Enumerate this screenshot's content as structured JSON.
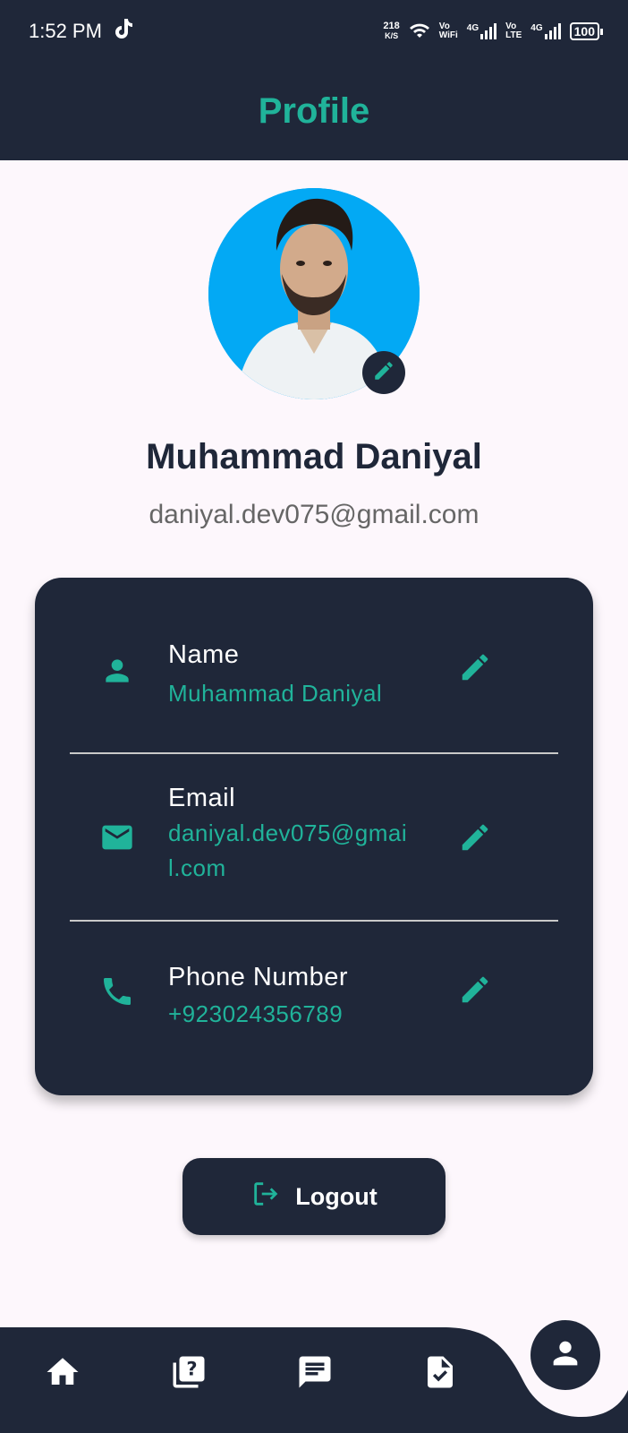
{
  "status_bar": {
    "time": "1:52 PM",
    "net_speed_value": "218",
    "net_speed_unit": "K/S",
    "vo_wifi_top": "Vo",
    "vo_wifi_bottom": "WiFi",
    "sim1_label": "4G",
    "vo_lte_top": "Vo",
    "vo_lte_bottom": "LTE",
    "sim2_label": "4G",
    "battery": "100"
  },
  "header": {
    "title": "Profile"
  },
  "profile": {
    "name": "Muhammad Daniyal",
    "email": "daniyal.dev075@gmail.com"
  },
  "details": [
    {
      "label": "Name",
      "value": "Muhammad Daniyal",
      "icon": "person-icon"
    },
    {
      "label": "Email",
      "value": "daniyal.dev075@gmail.com",
      "icon": "mail-icon"
    },
    {
      "label": "Phone Number",
      "value": "+923024356789",
      "icon": "phone-icon"
    }
  ],
  "logout": {
    "label": "Logout",
    "icon": "logout-icon"
  },
  "nav": {
    "items": [
      "home-icon",
      "quiz-icon",
      "chat-icon",
      "task-icon",
      "profile-icon"
    ],
    "active": "profile-icon"
  },
  "colors": {
    "dark": "#1f2739",
    "accent": "#20b39a",
    "background": "#fdf7fc",
    "avatar_bg": "#03a9f4"
  }
}
